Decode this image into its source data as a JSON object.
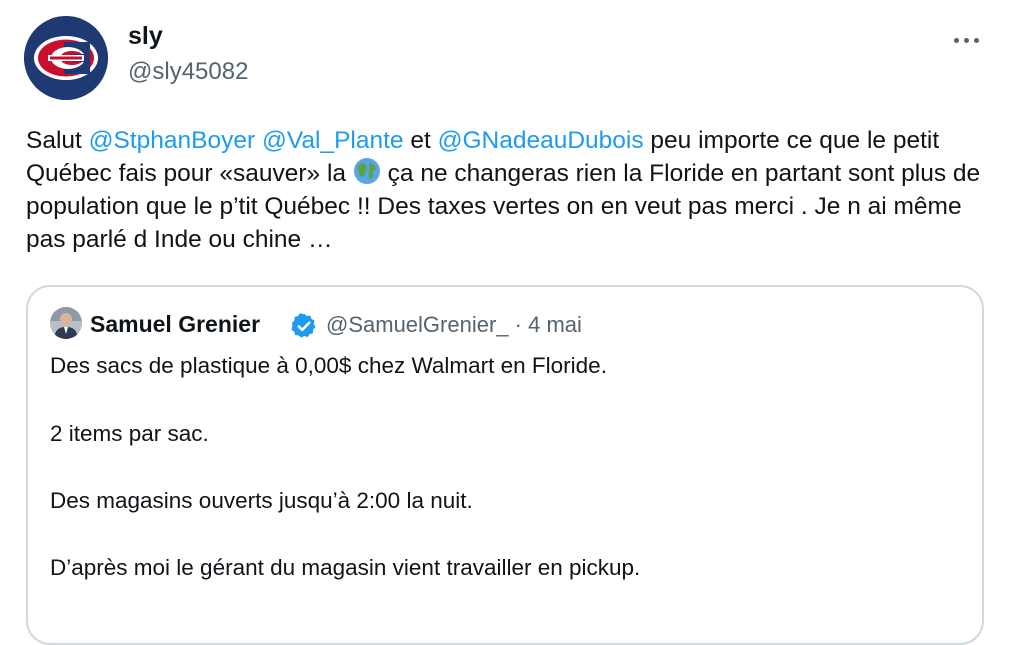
{
  "author": {
    "name": "sly",
    "handle": "@sly45082",
    "avatar_icon": "habs-logo-icon"
  },
  "tweet": {
    "text_1": "Salut ",
    "mention_1": "@StphanBoyer",
    "text_2": " ",
    "mention_2": "@Val_Plante",
    "text_3": " et ",
    "mention_3": "@GNadeauDubois",
    "text_4": " peu importe ce que le petit Québec fais pour «sauver» la ",
    "text_5": " ça ne changeras rien la Floride en partant sont plus de population que le p’tit Québec !! Des taxes vertes on en veut pas merci . Je n ai même pas parlé d Inde ou chine …"
  },
  "quote": {
    "name": "Samuel Grenier",
    "handle": "@SamuelGrenier_",
    "separator": "·",
    "date": "4 mai",
    "lines": [
      "Des sacs de plastique à 0,00$ chez Walmart en Floride.",
      "2 items par sac.",
      "Des magasins ouverts jusqu’à 2:00 la nuit.",
      "D’après moi le gérant du magasin vient travailler en pickup."
    ]
  },
  "colors": {
    "accent": "#1d9bf0",
    "muted": "#536471",
    "border": "#cfd9de"
  }
}
